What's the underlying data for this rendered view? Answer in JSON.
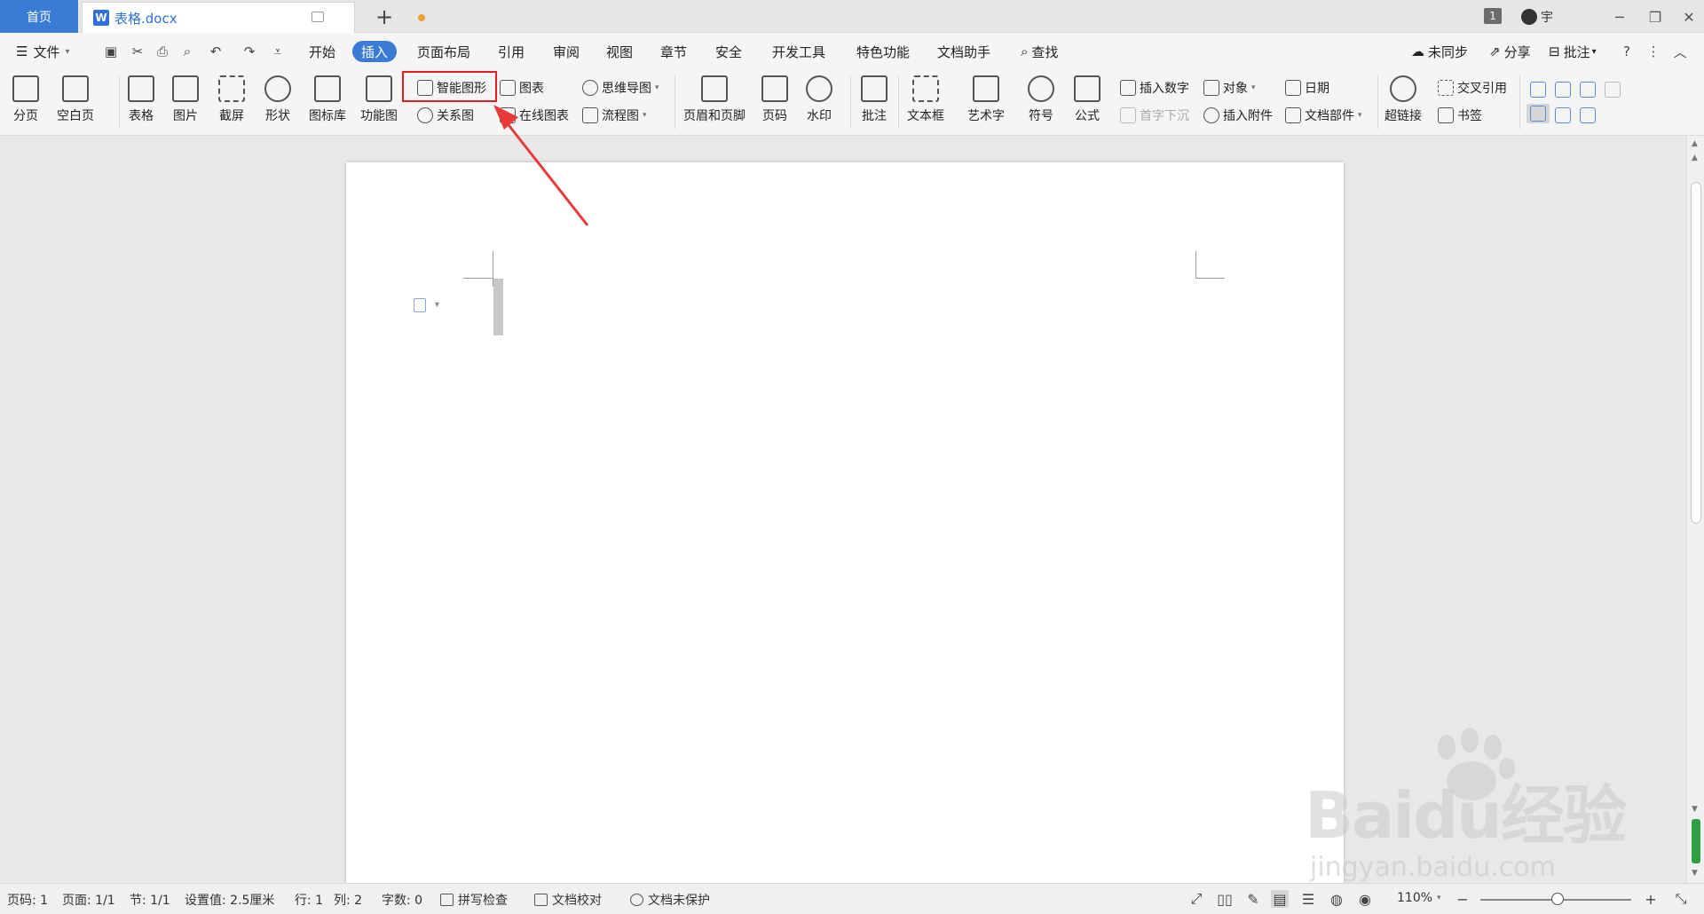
{
  "tabs": {
    "home": "首页",
    "doc_title": "表格.docx",
    "doc_icon_letter": "W",
    "add": "+"
  },
  "titlebar_right": {
    "badge": "1",
    "user": "宇"
  },
  "menu": {
    "file": "文件",
    "items": [
      "开始",
      "插入",
      "页面布局",
      "引用",
      "审阅",
      "视图",
      "章节",
      "安全",
      "开发工具",
      "特色功能",
      "文档助手"
    ],
    "active": "插入",
    "search": "查找",
    "sync": "未同步",
    "share": "分享",
    "annotate": "批注"
  },
  "ribbon": {
    "page_break": "分页",
    "blank_page": "空白页",
    "table": "表格",
    "picture": "图片",
    "screenshot": "截屏",
    "shape": "形状",
    "icon_lib": "图标库",
    "func_chart": "功能图",
    "smart_art": "智能图形",
    "relation": "关系图",
    "chart": "图表",
    "online_chart": "在线图表",
    "mind_map": "思维导图",
    "flowchart": "流程图",
    "header_footer": "页眉和页脚",
    "page_num": "页码",
    "watermark": "水印",
    "comment": "批注",
    "textbox": "文本框",
    "wordart": "艺术字",
    "symbol": "符号",
    "formula": "公式",
    "insert_number": "插入数字",
    "drop_cap": "首字下沉",
    "object": "对象",
    "attachment": "插入附件",
    "date": "日期",
    "doc_parts": "文档部件",
    "hyperlink": "超链接",
    "cross_ref": "交叉引用",
    "bookmark": "书签"
  },
  "status": {
    "page": "页码: 1",
    "pages": "页面: 1/1",
    "section": "节: 1/1",
    "setting": "设置值: 2.5厘米",
    "row": "行: 1",
    "col": "列: 2",
    "words": "字数: 0",
    "spell": "拼写检查",
    "proof": "文档校对",
    "protect": "文档未保护",
    "zoom": "110%"
  },
  "watermark": {
    "brand": "Baidu经验",
    "url": "jingyan.baidu.com"
  },
  "colors": {
    "accent": "#3a7bd5",
    "highlight": "#e02020",
    "arrow": "#e83a3a"
  }
}
